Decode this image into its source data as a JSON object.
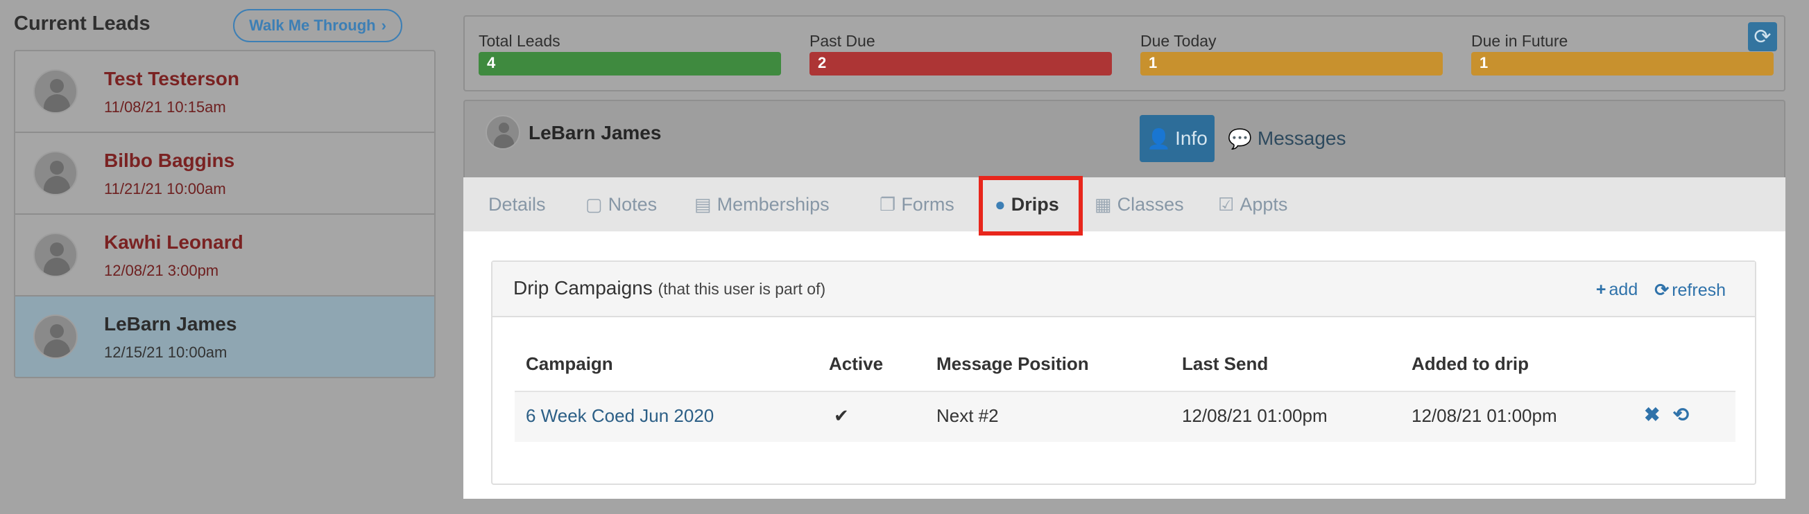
{
  "left": {
    "title": "Current Leads",
    "walk_button": "Walk Me Through",
    "walk_button_icon": "›",
    "leads": [
      {
        "name": "Test Testerson",
        "date": "11/08/21 10:15am"
      },
      {
        "name": "Bilbo Baggins",
        "date": "11/21/21 10:00am"
      },
      {
        "name": "Kawhi Leonard",
        "date": "12/08/21 3:00pm"
      },
      {
        "name": "LeBarn James",
        "date": "12/15/21 10:00am"
      }
    ]
  },
  "stats": [
    {
      "label": "Total Leads",
      "value": "4",
      "color": "#3d8a3d"
    },
    {
      "label": "Past Due",
      "value": "2",
      "color": "#ad3535"
    },
    {
      "label": "Due Today",
      "value": "1",
      "color": "#c8912e"
    },
    {
      "label": "Due in Future",
      "value": "1",
      "color": "#c8912e"
    }
  ],
  "refresh_icon": "⟳",
  "profile": {
    "name": "LeBarn James",
    "info_button": "Info",
    "messages_button": "Messages"
  },
  "tabs": [
    {
      "label": "Details",
      "icon": ""
    },
    {
      "label": "Notes",
      "icon": "▢"
    },
    {
      "label": "Memberships",
      "icon": "▤"
    },
    {
      "label": "Forms",
      "icon": "❐"
    },
    {
      "label": "Drips",
      "icon": "💧"
    },
    {
      "label": "Classes",
      "icon": "▦"
    },
    {
      "label": "Appts",
      "icon": "☑"
    }
  ],
  "panel": {
    "title": "Drip Campaigns",
    "subtitle": "(that this user is part of)",
    "add_label": "add",
    "refresh_label": "refresh",
    "add_icon": "+",
    "refresh_icon": "⟳"
  },
  "table": {
    "headers": [
      "Campaign",
      "Active",
      "Message Position",
      "Last Send",
      "Added to drip"
    ],
    "rows": [
      {
        "campaign": "6 Week Coed Jun 2020",
        "active": "✔",
        "position": "Next #2",
        "last_send": "12/08/21 01:00pm",
        "added": "12/08/21 01:00pm",
        "remove_icon": "✖",
        "reset_icon": "⟲"
      }
    ]
  }
}
